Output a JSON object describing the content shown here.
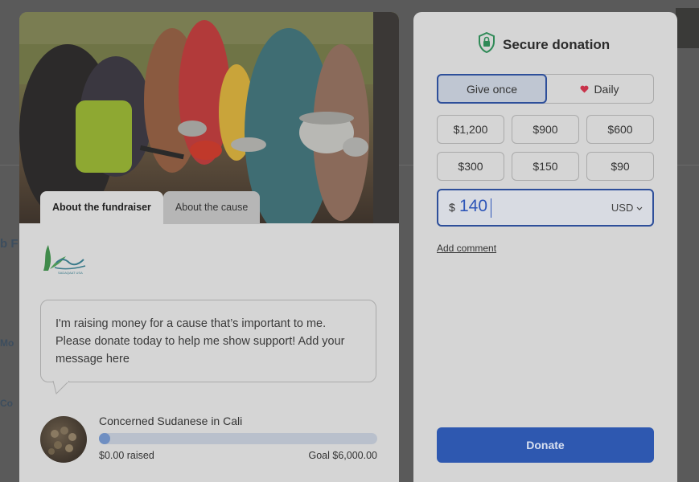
{
  "background": {
    "fragments": [
      "b F",
      "Mo",
      "Co"
    ]
  },
  "fundraiser": {
    "tabs": [
      {
        "label": "About the fundraiser",
        "active": true
      },
      {
        "label": "About the cause",
        "active": false
      }
    ],
    "logo_text": "SADAQAAT USA",
    "message": "I'm raising money for a cause that’s important to me. Please donate today to help me show support! Add your message here",
    "org_name": "Concerned Sudanese in Cali",
    "raised": "$0.00 raised",
    "goal": "Goal $6,000.00",
    "progress_fraction": 0.04
  },
  "donation": {
    "title": "Secure donation",
    "frequency": [
      {
        "label": "Give once",
        "active": true
      },
      {
        "label": "Daily",
        "active": false,
        "icon": "heart-icon"
      }
    ],
    "amounts": [
      "$1,200",
      "$900",
      "$600",
      "$300",
      "$150",
      "$90"
    ],
    "currency_symbol": "$",
    "amount_value": "140",
    "currency": "USD",
    "add_comment": "Add comment",
    "donate_label": "Donate"
  },
  "colors": {
    "accent": "#2e58b0",
    "heart": "#c8324a",
    "shield": "#2f8a57"
  }
}
